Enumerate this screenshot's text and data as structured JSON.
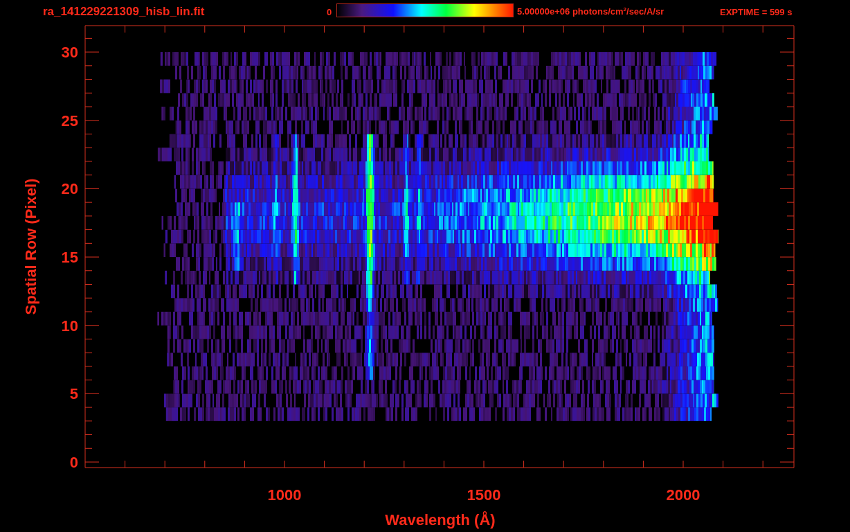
{
  "header": {
    "filename": "ra_141229221309_hisb_lin.fit",
    "colorbar": {
      "min_label": "0",
      "max_label": "5.00000e+06 photons/cm$^{2}$/sec/A/sr"
    },
    "exposure": "EXPTIME = 599 s"
  },
  "plot": {
    "x_axis": {
      "label": "Wavelength (Å)",
      "tick_labels": [
        "1000",
        "1500",
        "2000"
      ]
    },
    "y_axis": {
      "label": "Spatial Row (Pixel)",
      "tick_labels": [
        "30",
        "25",
        "20",
        "15",
        "10",
        "5",
        "0"
      ]
    }
  }
}
